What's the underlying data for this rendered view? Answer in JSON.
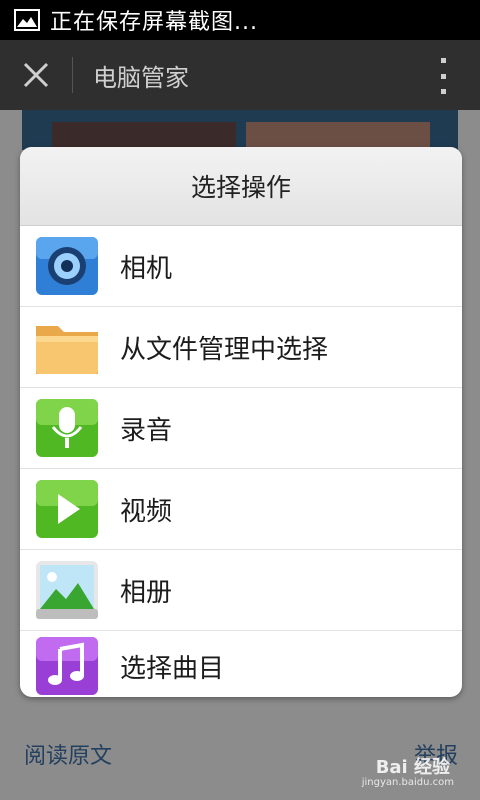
{
  "status_bar": {
    "text": "正在保存屏幕截图..."
  },
  "header": {
    "title": "电脑管家"
  },
  "dialog": {
    "title": "选择操作",
    "options": [
      {
        "label": "相机",
        "icon": "camera-icon"
      },
      {
        "label": "从文件管理中选择",
        "icon": "folder-icon"
      },
      {
        "label": "录音",
        "icon": "microphone-icon"
      },
      {
        "label": "视频",
        "icon": "video-play-icon"
      },
      {
        "label": "相册",
        "icon": "gallery-icon"
      },
      {
        "label": "选择曲目",
        "icon": "music-note-icon"
      }
    ]
  },
  "footer": {
    "read_original": "阅读原文",
    "report": "举报",
    "watermark": "Bai 经验",
    "watermark_sub": "jingyan.baidu.com"
  },
  "colors": {
    "status_bar_bg": "#000000",
    "header_bg": "#2f2f2f",
    "footer_link": "#23405f"
  }
}
